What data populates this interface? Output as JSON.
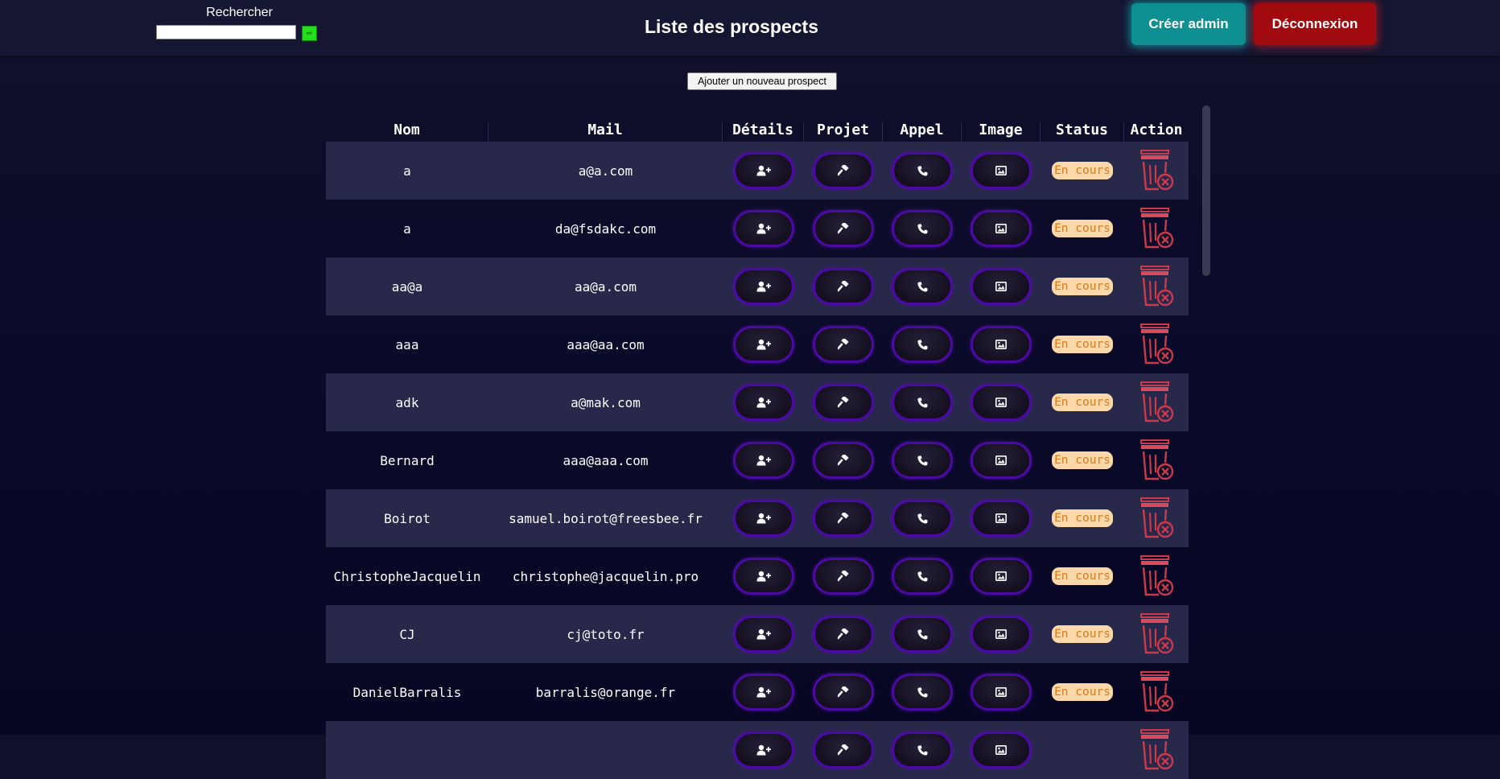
{
  "header": {
    "search_label": "Rechercher",
    "search_value": "",
    "search_button": "⇨",
    "title": "Liste des prospects",
    "admin_button": "Créer admin",
    "logout_button": "Déconnexion"
  },
  "add_button": "Ajouter un nouveau prospect",
  "table": {
    "headers": [
      "Nom",
      "Mail",
      "Détails",
      "Projet",
      "Appel",
      "Image",
      "Status",
      "Action"
    ],
    "rows": [
      {
        "nom": "a",
        "mail": "a@a.com",
        "status": "En cours"
      },
      {
        "nom": "a",
        "mail": "da@fsdakc.com",
        "status": "En cours"
      },
      {
        "nom": "aa@a",
        "mail": "aa@a.com",
        "status": "En cours"
      },
      {
        "nom": "aaa",
        "mail": "aaa@aa.com",
        "status": "En cours"
      },
      {
        "nom": "adk",
        "mail": "a@mak.com",
        "status": "En cours"
      },
      {
        "nom": "Bernard",
        "mail": "aaa@aaa.com",
        "status": "En cours"
      },
      {
        "nom": "Boirot",
        "mail": "samuel.boirot@freesbee.fr",
        "status": "En cours"
      },
      {
        "nom": "ChristopheJacquelin",
        "mail": "christophe@jacquelin.pro",
        "status": "En cours"
      },
      {
        "nom": "CJ",
        "mail": "cj@toto.fr",
        "status": "En cours"
      },
      {
        "nom": "DanielBarralis",
        "mail": "barralis@orange.fr",
        "status": "En cours"
      },
      {
        "nom": "",
        "mail": "",
        "status": ""
      }
    ],
    "row_icons": [
      "user-plus-icon",
      "hammer-icon",
      "phone-icon",
      "image-icon",
      "trash-delete-icon"
    ]
  },
  "colors": {
    "admin": "#0e8f92",
    "logout": "#a10a0f",
    "pill_border": "#4c0aa4",
    "status_bg": "#fcd7a9",
    "status_text": "#d77a1b",
    "trash": "#c93a4a"
  }
}
